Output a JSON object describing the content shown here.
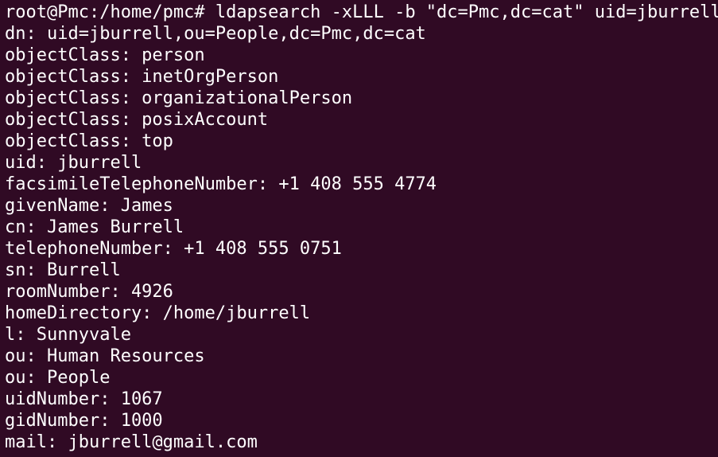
{
  "terminal": {
    "prompt": "root@Pmc:/home/pmc# ",
    "command": "ldapsearch -xLLL -b \"dc=Pmc,dc=cat\" uid=jburrell",
    "output": [
      "dn: uid=jburrell,ou=People,dc=Pmc,dc=cat",
      "objectClass: person",
      "objectClass: inetOrgPerson",
      "objectClass: organizationalPerson",
      "objectClass: posixAccount",
      "objectClass: top",
      "uid: jburrell",
      "facsimileTelephoneNumber: +1 408 555 4774",
      "givenName: James",
      "cn: James Burrell",
      "telephoneNumber: +1 408 555 0751",
      "sn: Burrell",
      "roomNumber: 4926",
      "homeDirectory: /home/jburrell",
      "l: Sunnyvale",
      "ou: Human Resources",
      "ou: People",
      "uidNumber: 1067",
      "gidNumber: 1000",
      "mail: jburrell@gmail.com"
    ],
    "colors": {
      "background": "#300a24",
      "foreground": "#ffffff"
    }
  }
}
